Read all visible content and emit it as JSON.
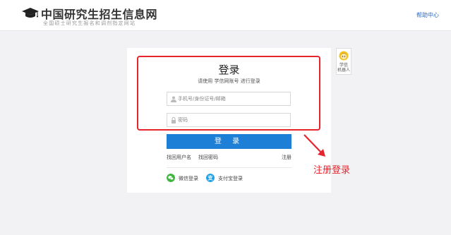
{
  "header": {
    "site_title": "中国研究生招生信息网",
    "site_subtitle": "全国硕士研究生报名和调剂指定网站",
    "help_link": "帮助中心"
  },
  "login": {
    "title": "登录",
    "hint": "请使用 学信网账号 进行登录",
    "username_placeholder": "手机号/身份证号/邮箱",
    "password_placeholder": "密码",
    "submit_label": "登 录",
    "links": {
      "find_username": "找回用户名",
      "find_password": "找回密码",
      "register": "注册"
    },
    "social": {
      "wechat": "微信登录",
      "alipay": "支付宝登录"
    }
  },
  "robot": {
    "label_line1": "学信",
    "label_line2": "机器人"
  },
  "annotation": {
    "text": "注册登录"
  },
  "icons": {
    "logo": "graduation-cap-icon",
    "user": "user-icon",
    "lock": "lock-icon",
    "wechat": "wechat-icon",
    "alipay": "alipay-icon",
    "robot": "robot-avatar-icon"
  },
  "colors": {
    "accent": "#1e7fd6",
    "annotation_red": "#e8232d",
    "wechat_green": "#3bb53b",
    "alipay_blue": "#1d9fe8",
    "link_blue": "#2b6cc4"
  }
}
